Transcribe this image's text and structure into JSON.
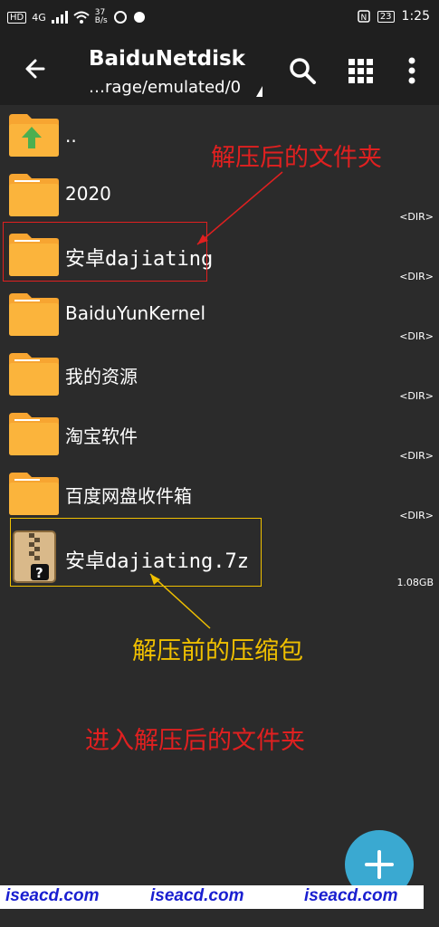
{
  "status": {
    "left_badge": "HD",
    "network": "4G",
    "speed": "37\nB/s",
    "battery": "23",
    "time": "1:25"
  },
  "toolbar": {
    "title": "BaiduNetdisk",
    "path": "…rage/emulated/0",
    "icons": [
      "back-arrow-icon",
      "search-icon",
      "grid-view-icon",
      "more-vert-icon"
    ]
  },
  "files": [
    {
      "name": "..",
      "meta": "",
      "type": "parent"
    },
    {
      "name": "2020",
      "meta": "<DIR>",
      "type": "folder"
    },
    {
      "name": "安卓dajiating",
      "meta": "<DIR>",
      "type": "folder"
    },
    {
      "name": "BaiduYunKernel",
      "meta": "<DIR>",
      "type": "folder"
    },
    {
      "name": "我的资源",
      "meta": "<DIR>",
      "type": "folder"
    },
    {
      "name": "淘宝软件",
      "meta": "<DIR>",
      "type": "folder"
    },
    {
      "name": "百度网盘收件箱",
      "meta": "<DIR>",
      "type": "folder"
    },
    {
      "name": "安卓dajiating.7z",
      "meta": "1.08GB",
      "type": "archive"
    }
  ],
  "annotations": {
    "after_extract": "解压后的文件夹",
    "before_extract": "解压前的压缩包",
    "enter_folder": "进入解压后的文件夹"
  },
  "colors": {
    "red": "#e02020",
    "yellow": "#f0c000",
    "fab": "#3aa9d1",
    "folder": "#f7a531"
  },
  "watermark": [
    "iseacd.com",
    "iseacd.com",
    "iseacd.com"
  ]
}
